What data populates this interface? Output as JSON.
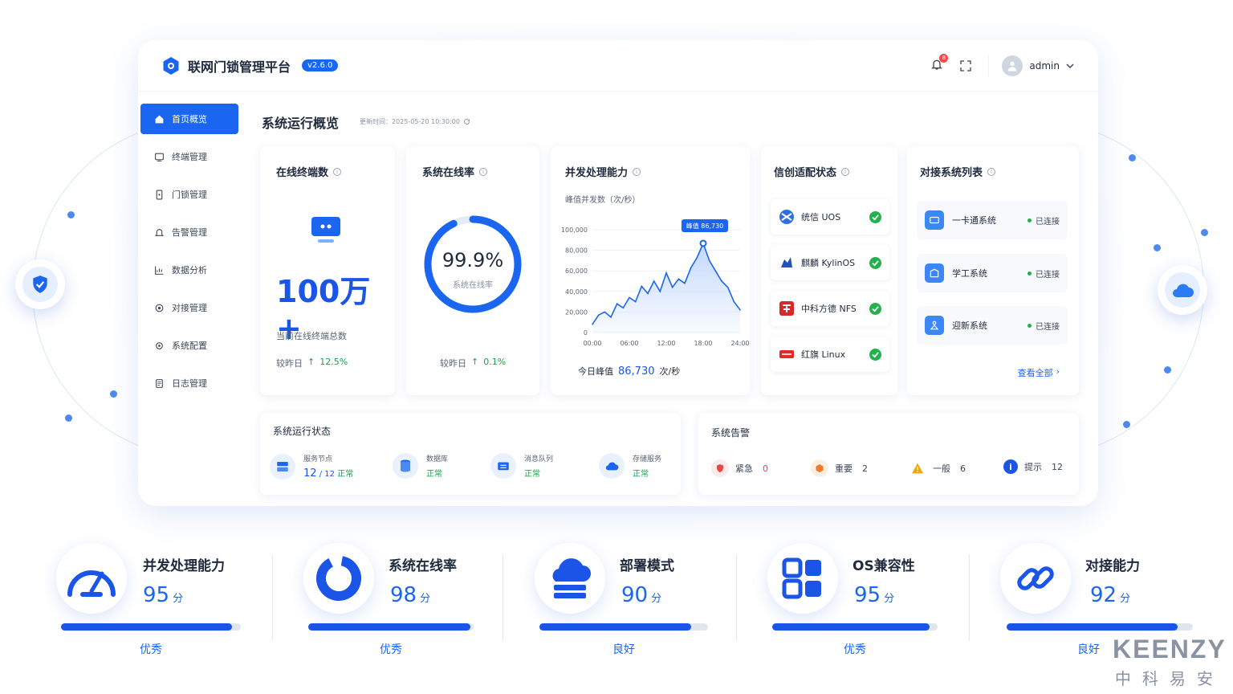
{
  "app": {
    "title": "联网门锁管理平台",
    "version": "v2.6.0",
    "notifications": "8",
    "user": "admin"
  },
  "sidebar": {
    "items": [
      {
        "label": "首页概览",
        "icon": "home-icon",
        "active": true
      },
      {
        "label": "终端管理",
        "icon": "terminal-icon"
      },
      {
        "label": "门锁管理",
        "icon": "lock-icon"
      },
      {
        "label": "告警管理",
        "icon": "bell-icon"
      },
      {
        "label": "数据分析",
        "icon": "chart-icon"
      },
      {
        "label": "对接管理",
        "icon": "link-icon"
      },
      {
        "label": "系统配置",
        "icon": "gear-icon"
      },
      {
        "label": "日志管理",
        "icon": "log-icon"
      }
    ]
  },
  "main": {
    "title": "系统运行概览",
    "update": "更新时间：2025-05-20 10:30:00"
  },
  "online": {
    "title": "在线终端数",
    "value": "100万+",
    "desc": "当前在线终端总数",
    "cmp_label": "较昨日",
    "cmp_value": "12.5%"
  },
  "uptime": {
    "title": "系统在线率",
    "value": "99.9%",
    "label": "系统在线率",
    "rate": 0.999,
    "cmp_label": "较昨日",
    "cmp_value": "0.1%"
  },
  "concurrency": {
    "title": "并发处理能力",
    "subtitle": "峰值并发数（次/秒）",
    "peak_label": "今日峰值",
    "peak_value": "86,730",
    "peak_unit": "次/秒",
    "tooltip": "峰值 86,730"
  },
  "chart_data": {
    "type": "area",
    "x": [
      "00:00",
      "01:00",
      "02:00",
      "03:00",
      "04:00",
      "05:00",
      "06:00",
      "07:00",
      "08:00",
      "09:00",
      "10:00",
      "11:00",
      "12:00",
      "13:00",
      "14:00",
      "15:00",
      "16:00",
      "17:00",
      "18:00",
      "19:00",
      "20:00",
      "21:00",
      "22:00",
      "23:00",
      "24:00"
    ],
    "y": [
      8000,
      17000,
      20000,
      15000,
      28000,
      24000,
      34000,
      30000,
      45000,
      38000,
      50000,
      40000,
      58000,
      44000,
      52000,
      48000,
      63000,
      73000,
      86730,
      70000,
      60000,
      50000,
      44000,
      30000,
      22000
    ],
    "xticks": [
      "00:00",
      "06:00",
      "12:00",
      "18:00",
      "24:00"
    ],
    "yticks": [
      "0",
      "20,000",
      "40,000",
      "60,000",
      "80,000",
      "100,000"
    ],
    "ylim": [
      0,
      100000
    ],
    "colors": {
      "line": "#1a66f0",
      "fill": "#bcd4ff"
    }
  },
  "xinchuang": {
    "title": "信创适配状态",
    "items": [
      {
        "name": "统信 UOS",
        "icon": "uos-icon"
      },
      {
        "name": "麒麟 KylinOS",
        "icon": "kylin-icon"
      },
      {
        "name": "中科方德 NFS",
        "icon": "nfs-icon"
      },
      {
        "name": "红旗 Linux",
        "icon": "redflag-icon"
      }
    ]
  },
  "integrations": {
    "title": "对接系统列表",
    "more": "查看全部",
    "items": [
      {
        "name": "一卡通系统",
        "status": "已连接"
      },
      {
        "name": "学工系统",
        "status": "已连接"
      },
      {
        "name": "迎新系统",
        "status": "已连接"
      }
    ]
  },
  "runstatus": {
    "title": "系统运行状态",
    "items": [
      {
        "label": "服务节点",
        "value": "12",
        "total": "12",
        "status": "正常"
      },
      {
        "label": "数据库",
        "status": "正常"
      },
      {
        "label": "消息队列",
        "status": "正常"
      },
      {
        "label": "存储服务",
        "status": "正常"
      }
    ]
  },
  "alerts": {
    "title": "系统告警",
    "items": [
      {
        "label": "紧急",
        "count": "0",
        "color": "#e84545"
      },
      {
        "label": "重要",
        "count": "2",
        "color": "#f07a2a"
      },
      {
        "label": "一般",
        "count": "6",
        "color": "#f2a800"
      },
      {
        "label": "提示",
        "count": "12",
        "color": "#1a55e8"
      }
    ]
  },
  "metrics": [
    {
      "title": "并发处理能力",
      "score": "95",
      "unit": "分",
      "fraction": 0.95,
      "grade": "优秀",
      "icon": "speedometer-icon"
    },
    {
      "title": "系统在线率",
      "score": "98",
      "unit": "分",
      "fraction": 0.98,
      "grade": "优秀",
      "icon": "donut-icon"
    },
    {
      "title": "部署模式",
      "score": "90",
      "unit": "分",
      "fraction": 0.9,
      "grade": "良好",
      "icon": "cloud-server-icon"
    },
    {
      "title": "OS兼容性",
      "score": "95",
      "unit": "分",
      "fraction": 0.95,
      "grade": "优秀",
      "icon": "grid-icon"
    },
    {
      "title": "对接能力",
      "score": "92",
      "unit": "分",
      "fraction": 0.92,
      "grade": "良好",
      "icon": "link-icon"
    }
  ],
  "brand": {
    "en": "KEENZY",
    "cn": "中科易安"
  }
}
